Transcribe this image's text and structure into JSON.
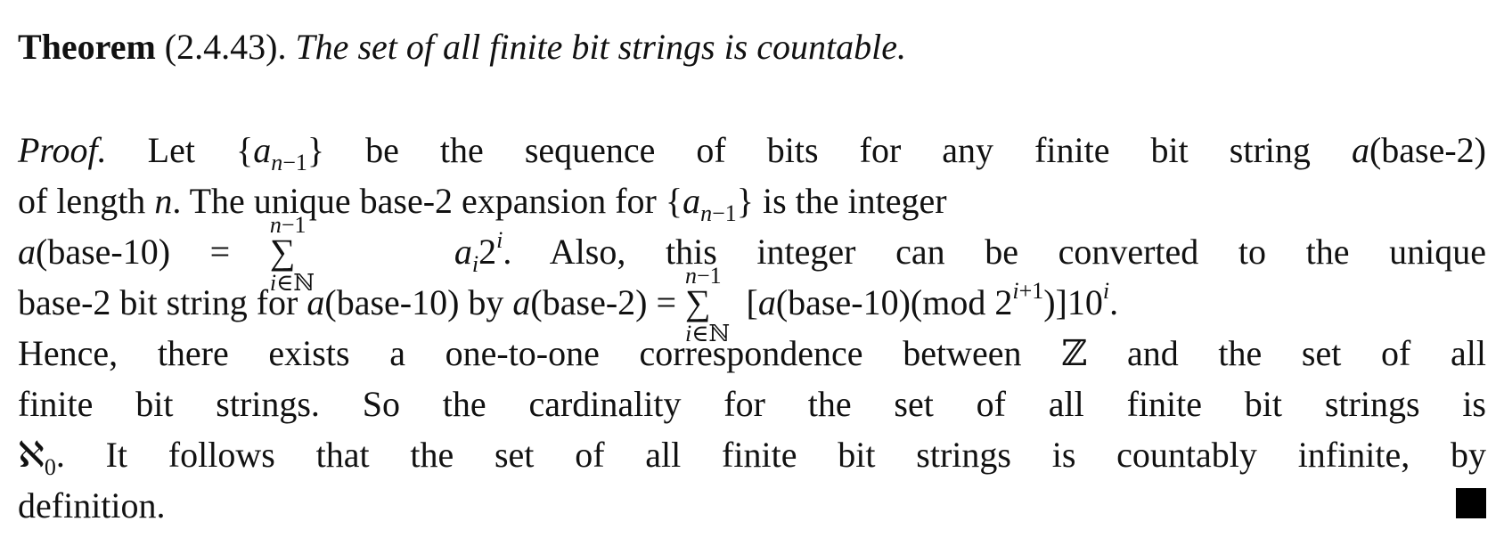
{
  "theorem": {
    "label": "Theorem",
    "number": "(2.4.43).",
    "statement": "The set of all finite bit strings is countable."
  },
  "proof": {
    "label": "Proof.",
    "lines": [
      "Let {a_{n−1}} be the sequence of bits for any finite bit string a(base-2)",
      "of length n. The unique base-2 expansion for {a_{n−1}} is the integer",
      "a(base-10) = ∑_{i∈ℕ}^{n−1} a_i 2^i. Also, this integer can be converted to the unique",
      "base-2 bit string for a(base-10) by a(base-2) = ∑_{i∈ℕ}^{n−1} [a(base-10)(mod 2^{i+1})]10^i.",
      "Hence, there exists a one-to-one correspondence between ℤ and the set of all",
      "finite bit strings. So the cardinality for the set of all finite bit strings is",
      "ℵ_0. It follows that the set of all finite bit strings is countably infinite, by",
      "definition."
    ],
    "qed_symbol": "■"
  }
}
